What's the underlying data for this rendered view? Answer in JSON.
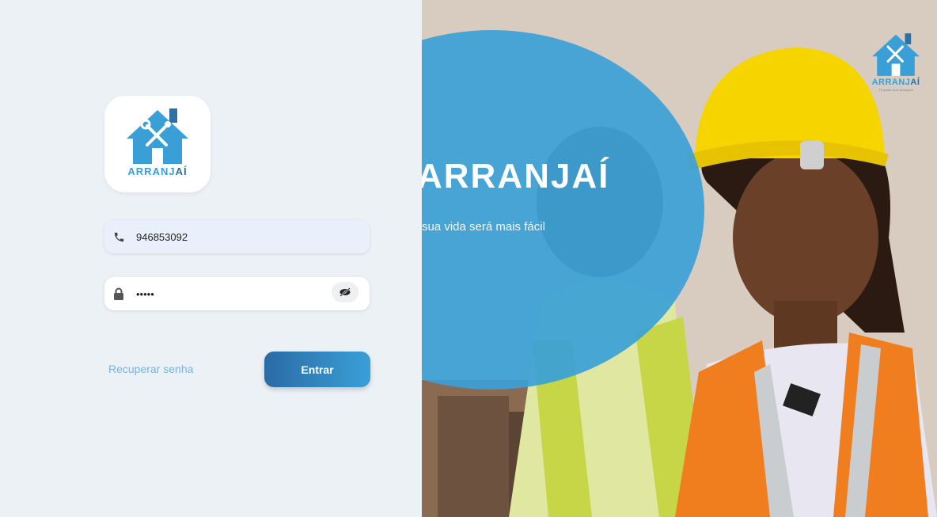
{
  "brand": {
    "name_part1": "ARRANJ",
    "name_part2": "AÍ",
    "accent": "#3a9fd6",
    "accent_dark": "#2f6fa3"
  },
  "login": {
    "phone_icon": "phone-icon",
    "phone_value": "946853092",
    "password_icon": "lock-icon",
    "password_value": "•••••",
    "toggle_icon": "eye-off-icon",
    "recover_label": "Recuperar senha",
    "submit_label": "Entrar"
  },
  "hero": {
    "title": "ARRANJAÍ",
    "subtitle": "sua vida será mais fácil",
    "corner_logo_name_1": "ARRANJ",
    "corner_logo_name_2": "AÍ",
    "corner_logo_tagline": "Tá quase tudo arranjado"
  },
  "colors": {
    "left_bg": "#ecf1f6",
    "circle": "#3ba0d6",
    "button_start": "#2a6ba6",
    "button_end": "#3a9fd6"
  }
}
